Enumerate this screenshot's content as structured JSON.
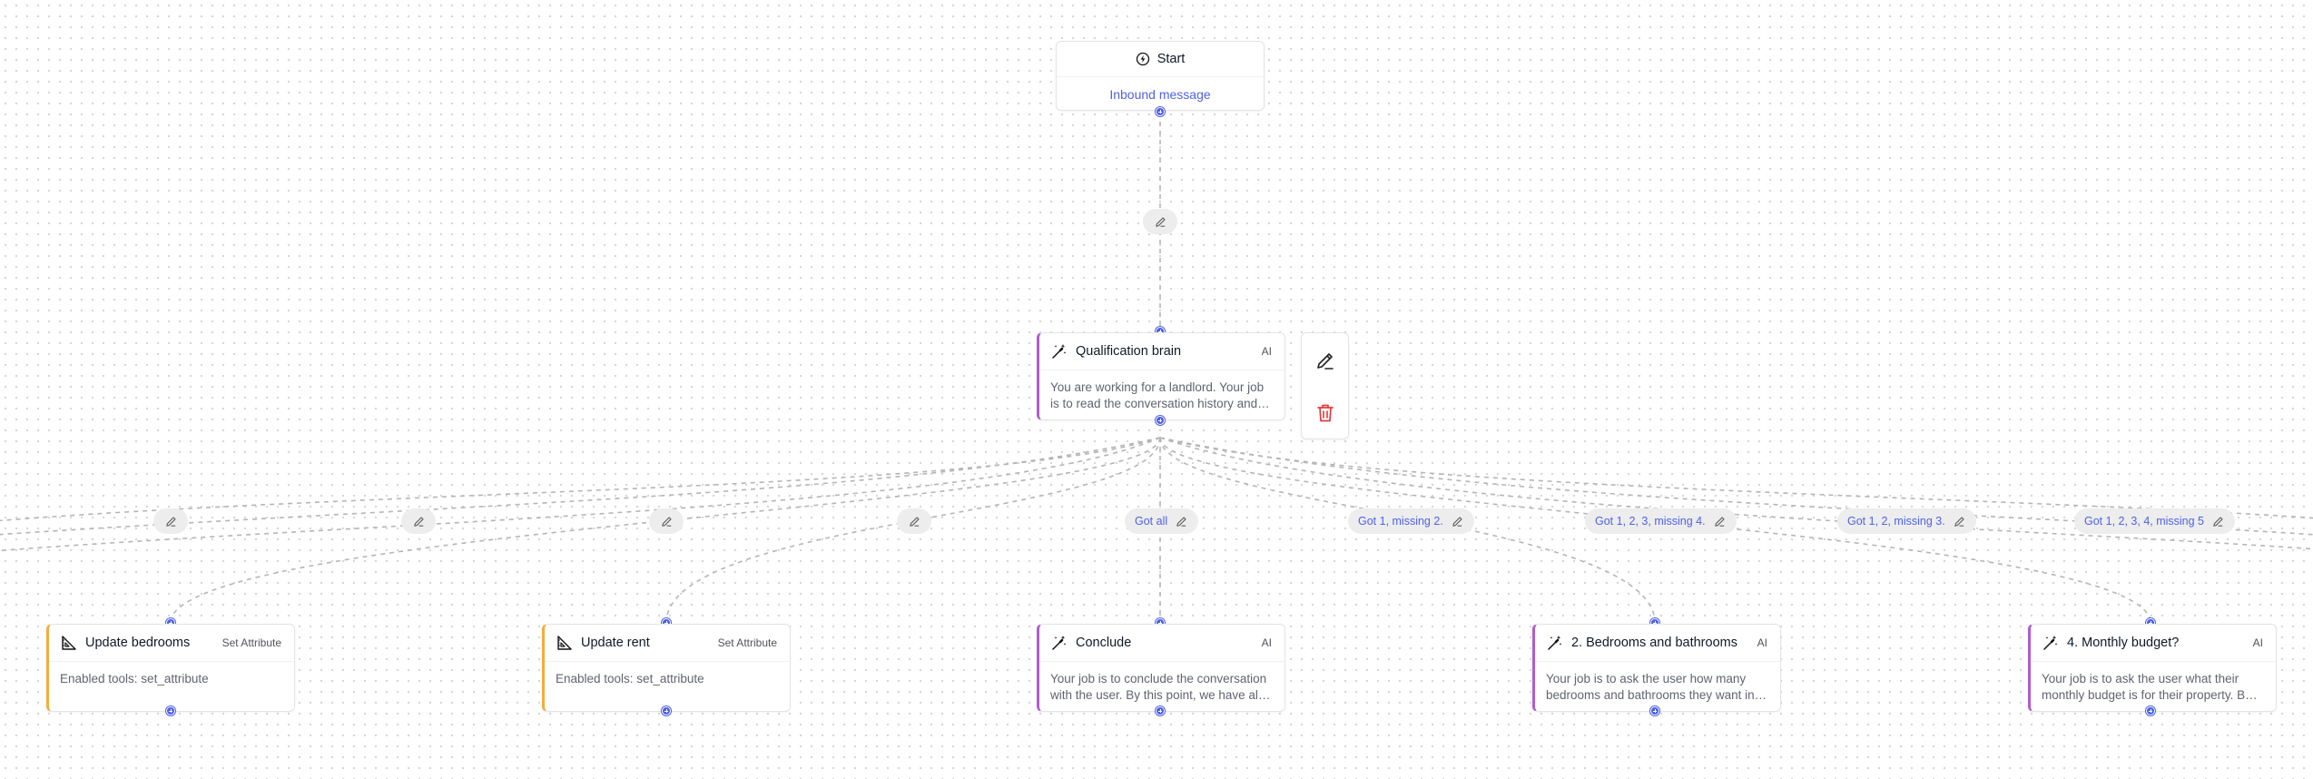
{
  "start": {
    "title": "Start",
    "trigger": "Inbound message"
  },
  "brain": {
    "title": "Qualification brain",
    "tag": "AI",
    "description": "You are working for a landlord. Your job is to read the conversation history and decide which step to take next."
  },
  "edges": [
    {
      "label": ""
    },
    {
      "label": ""
    },
    {
      "label": ""
    },
    {
      "label": ""
    },
    {
      "label": ""
    },
    {
      "label": "Got all"
    },
    {
      "label": "Got 1, missing 2."
    },
    {
      "label": "Got 1, 2, 3, missing 4."
    },
    {
      "label": "Got 1, 2, missing 3."
    },
    {
      "label": "Got 1, 2, 3, 4, missing 5"
    }
  ],
  "nodes": [
    {
      "title": "Update bedrooms",
      "tag": "Set Attribute",
      "description": "Enabled tools: set_attribute",
      "kind": "attr"
    },
    {
      "title": "Update rent",
      "tag": "Set Attribute",
      "description": "Enabled tools: set_attribute",
      "kind": "attr"
    },
    {
      "title": "Conclude",
      "tag": "AI",
      "description": "Your job is to conclude the conversation with the user. By this point, we have all the information we need.",
      "kind": "ai"
    },
    {
      "title": "2. Bedrooms and bathrooms",
      "tag": "AI",
      "description": "Your job is to ask the user how many bedrooms and bathrooms they want in their property.",
      "kind": "ai"
    },
    {
      "title": "4. Monthly budget?",
      "tag": "AI",
      "description": "Your job is to ask the user what their monthly budget is for their property. Be polite.",
      "kind": "ai"
    }
  ],
  "actions": {
    "edit": "pencil-icon",
    "delete": "trash-icon"
  },
  "colors": {
    "handle": "#4c5fe8",
    "ai_accent": "#b05bd2",
    "attr_accent": "#f2ad3b",
    "delete": "#e23b3b",
    "label": "#4f62e6"
  }
}
